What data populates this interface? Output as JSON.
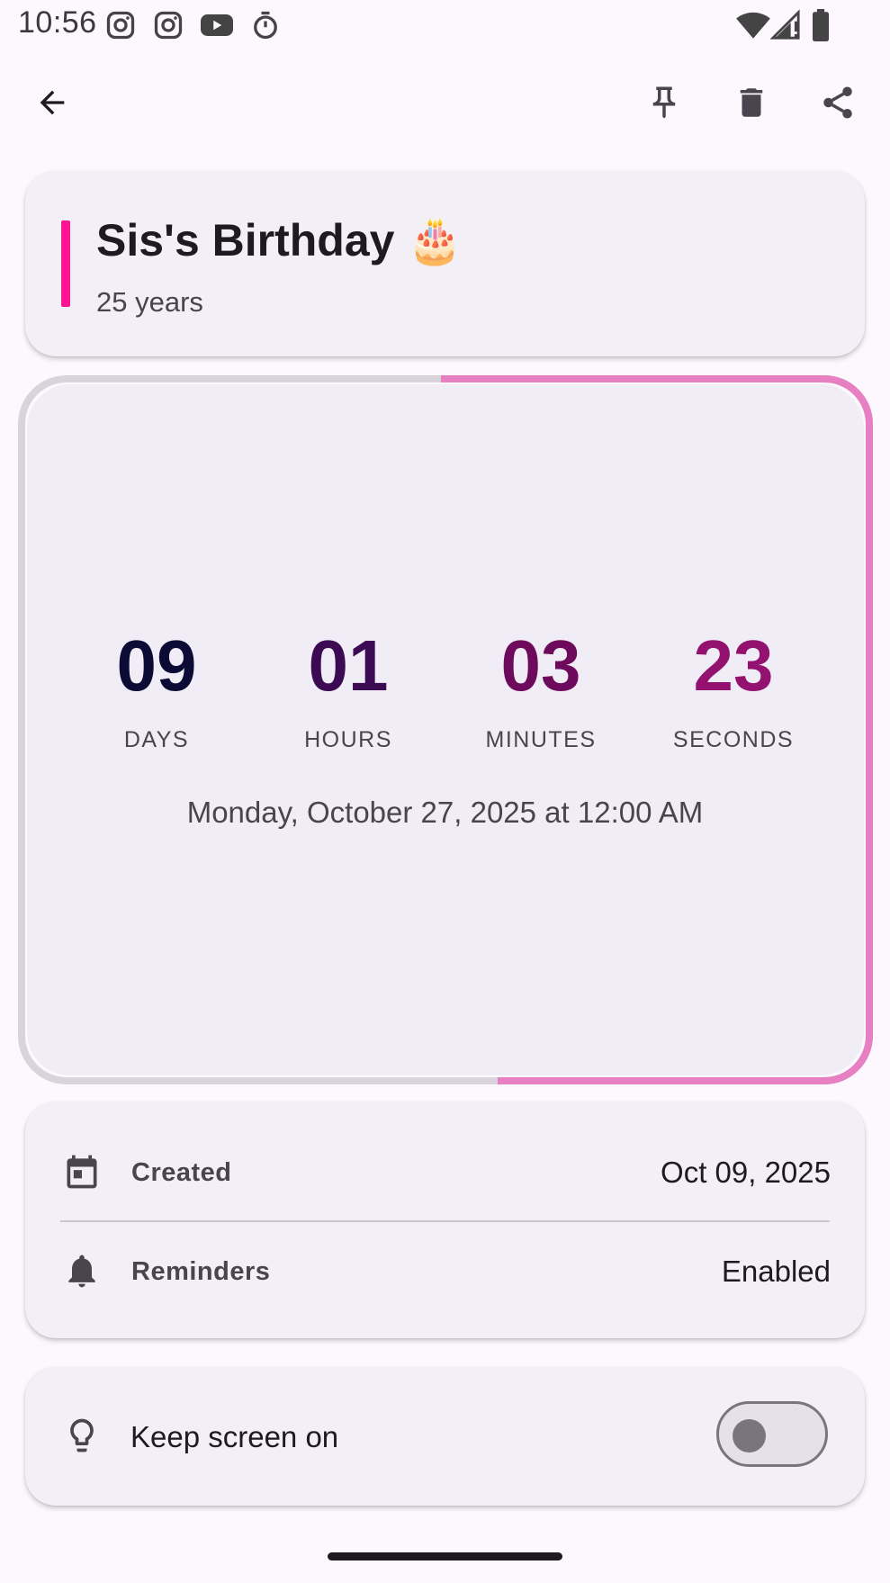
{
  "status_bar": {
    "time": "10:56",
    "left_icons": [
      "instagram-icon",
      "instagram-icon",
      "youtube-icon",
      "timer-icon"
    ],
    "right_icons": [
      "wifi-icon",
      "signal-icon",
      "battery-icon"
    ]
  },
  "app_bar": {
    "back_icon": "arrow-back-icon",
    "actions": [
      "pin-icon",
      "delete-icon",
      "share-icon"
    ]
  },
  "event": {
    "title": "Sis's Birthday 🎂",
    "subtitle": "25 years",
    "accent_color": "#ff1493"
  },
  "countdown": {
    "progress_color": "#e77fc3",
    "units": [
      {
        "value": "09",
        "label": "DAYS",
        "color": "#0b0b36"
      },
      {
        "value": "01",
        "label": "HOURS",
        "color": "#3c0a52"
      },
      {
        "value": "03",
        "label": "MINUTES",
        "color": "#6d0a5c"
      },
      {
        "value": "23",
        "label": "SECONDS",
        "color": "#93126f"
      }
    ],
    "target_date": "Monday, October 27, 2025 at 12:00 AM"
  },
  "details": {
    "created_label": "Created",
    "created_value": "Oct 09, 2025",
    "reminders_label": "Reminders",
    "reminders_value": "Enabled"
  },
  "keep_screen": {
    "label": "Keep screen on",
    "enabled": false
  }
}
